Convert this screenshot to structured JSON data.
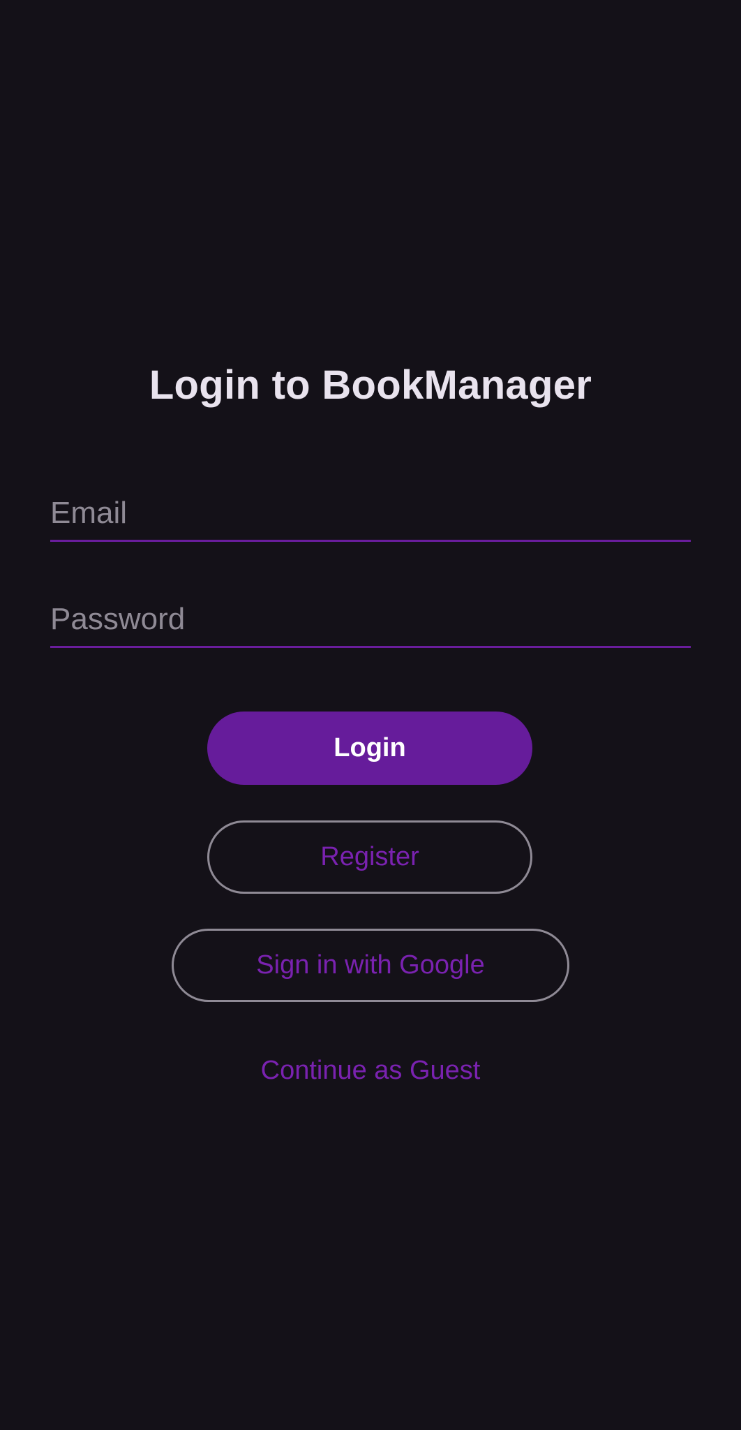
{
  "login_screen": {
    "title": "Login to BookManager",
    "email": {
      "placeholder": "Email",
      "value": ""
    },
    "password": {
      "placeholder": "Password",
      "value": ""
    },
    "login_button_label": "Login",
    "register_button_label": "Register",
    "google_button_label": "Sign in with Google",
    "guest_link_label": "Continue as Guest"
  },
  "colors": {
    "background": "#141118",
    "title_text": "#e9e3ee",
    "accent": "#661c9b",
    "accent_text": "#7a22b0",
    "outline": "#8f8a95",
    "placeholder": "#8f8a95"
  }
}
